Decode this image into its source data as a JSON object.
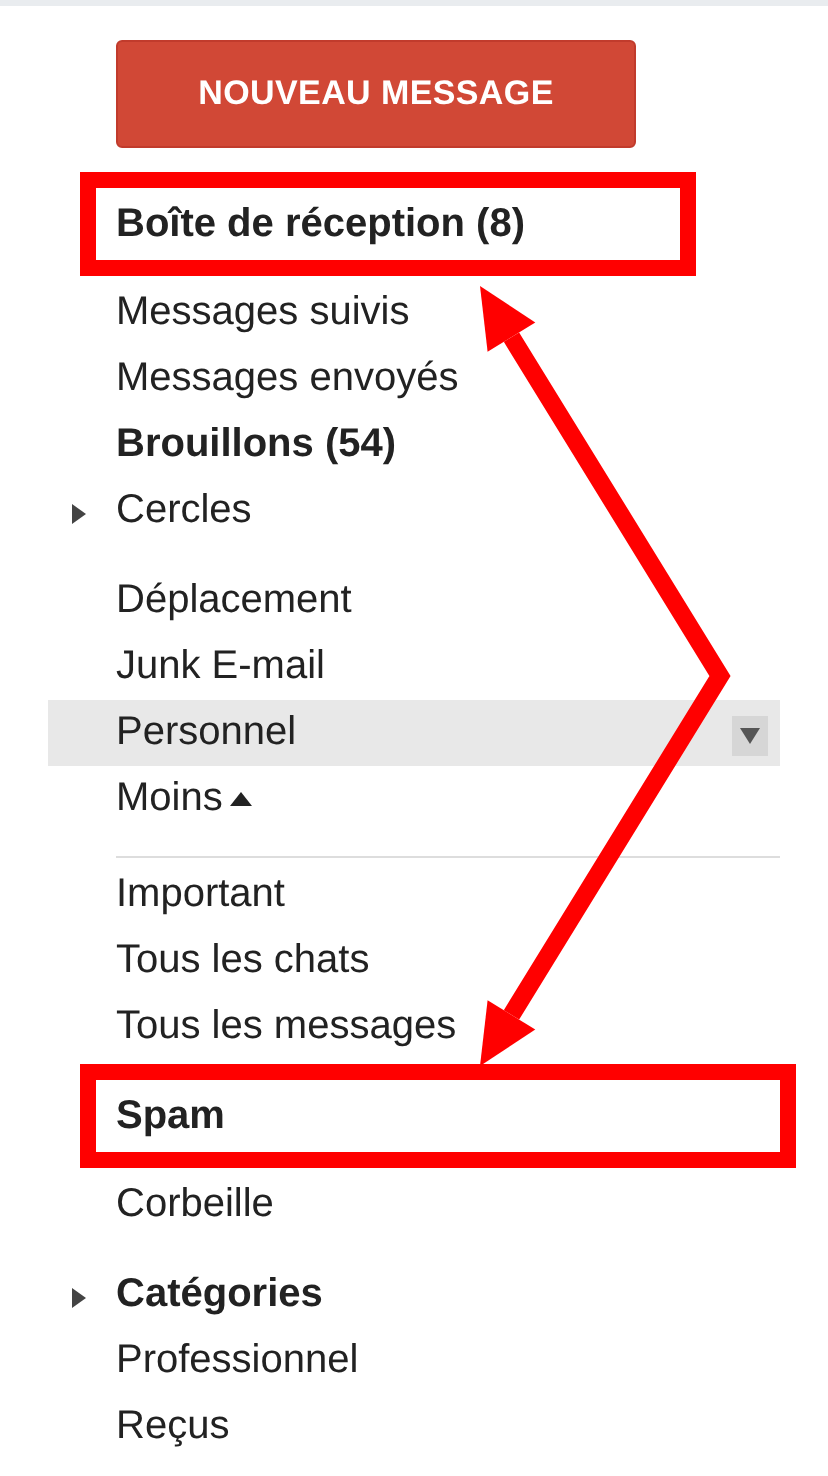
{
  "compose_button": {
    "label": "NOUVEAU MESSAGE"
  },
  "sections": [
    {
      "divider": false,
      "items": [
        {
          "label": "Boîte de réception (8)",
          "kind": "label",
          "bold": true,
          "selected": false,
          "annotated": true
        },
        {
          "label": "Messages suivis",
          "kind": "label",
          "bold": false,
          "selected": false,
          "annotated": false
        },
        {
          "label": "Messages envoyés",
          "kind": "label",
          "bold": false,
          "selected": false,
          "annotated": false
        },
        {
          "label": "Brouillons (54)",
          "kind": "label",
          "bold": true,
          "selected": false,
          "annotated": false
        },
        {
          "label": "Cercles",
          "kind": "expander",
          "bold": false,
          "selected": false,
          "annotated": false
        }
      ]
    },
    {
      "divider": false,
      "items": [
        {
          "label": "Déplacement",
          "kind": "label",
          "bold": false,
          "selected": false,
          "annotated": false
        },
        {
          "label": "Junk E-mail",
          "kind": "label",
          "bold": false,
          "selected": false,
          "annotated": false
        },
        {
          "label": "Personnel",
          "kind": "label",
          "bold": false,
          "selected": true,
          "annotated": false
        },
        {
          "label": "Moins",
          "kind": "less",
          "bold": false,
          "selected": false,
          "annotated": false
        }
      ]
    },
    {
      "divider": true,
      "items": [
        {
          "label": "Important",
          "kind": "label",
          "bold": false,
          "selected": false,
          "annotated": false
        },
        {
          "label": "Tous les chats",
          "kind": "label",
          "bold": false,
          "selected": false,
          "annotated": false
        },
        {
          "label": "Tous les messages",
          "kind": "label",
          "bold": false,
          "selected": false,
          "annotated": false
        },
        {
          "label": "Spam",
          "kind": "label",
          "bold": true,
          "selected": false,
          "annotated": true
        },
        {
          "label": "Corbeille",
          "kind": "label",
          "bold": false,
          "selected": false,
          "annotated": false
        }
      ]
    },
    {
      "divider": false,
      "items": [
        {
          "label": "Catégories",
          "kind": "expander",
          "bold": true,
          "selected": false,
          "annotated": false
        },
        {
          "label": "Professionnel",
          "kind": "label",
          "bold": false,
          "selected": false,
          "annotated": false
        },
        {
          "label": "Reçus",
          "kind": "label",
          "bold": false,
          "selected": false,
          "annotated": false
        }
      ]
    }
  ]
}
